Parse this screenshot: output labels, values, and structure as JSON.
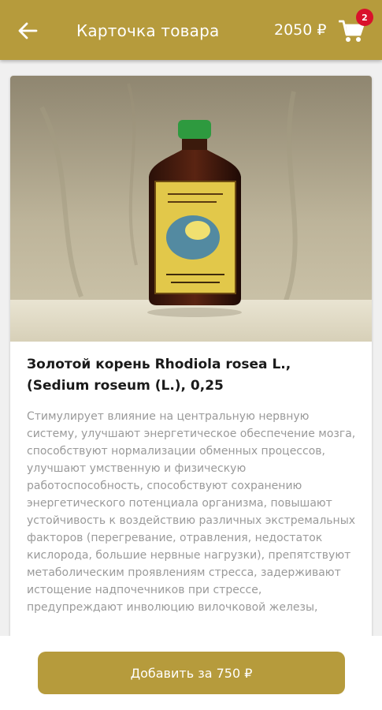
{
  "header": {
    "back_icon": "arrow-left-icon",
    "title": "Карточка товара",
    "cart_total": "2050 ₽",
    "cart_icon": "cart-icon",
    "cart_count": "2"
  },
  "product": {
    "title": "Золотой корень Rhodiola rosea L., (Sedium roseum (L.), 0,25",
    "description": "Стимулирует влияние на центральную нервную систему, улучшают энергетическое обеспечение мозга, способствуют нормализации обменных процессов, улучшают умственную и физическую работоспособность, способствуют сохранению энергетического потенциала организма, повышают устойчивость к воздействию различных экстремальных факторов (перегревание, отравления, недостаток кислорода, большие нервные нагрузки), препятствуют метаболическим проявлениям стресса, задерживают истощение надпочечников при стрессе, предупреждают инволюцию вилочковой железы,"
  },
  "actions": {
    "add_label": "Добавить за 750 ₽"
  },
  "colors": {
    "accent": "#b69b3c",
    "badge": "#d9112b",
    "background": "#f0f0f0"
  }
}
